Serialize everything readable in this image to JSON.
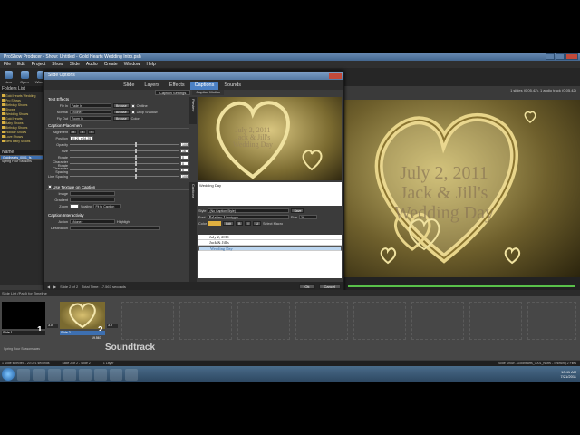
{
  "app": {
    "title": "ProShow Producer - Show: Untitled - Gold Hearts Wedding Intro.psh",
    "menu": [
      "File",
      "Edit",
      "Project",
      "Show",
      "Slide",
      "Audio",
      "Create",
      "Window",
      "Help"
    ],
    "toolbar": [
      "New",
      "Open",
      "Wizard"
    ],
    "info_right": "1 slides (0:05.42), 1 audio track (0:05.42)"
  },
  "left_panel": {
    "folders_title": "Folders List",
    "folders": [
      "Gold Hearts Wedding",
      "Pro Shows",
      "Birthday Shows",
      "Shows",
      "Wedding Shows",
      "Gold Hearts",
      "Baby Shows",
      "Birthday Shows",
      "Holiday Shows",
      "Love Shows",
      "New Baby Shows"
    ],
    "files_title": "Name",
    "files": [
      {
        "name": "Goldhearts_0001_fs",
        "selected": true
      },
      {
        "name": "Spring Four Seasons"
      }
    ]
  },
  "dialog": {
    "title": "Slide Options",
    "tabs": [
      {
        "label": "Slide",
        "active": false
      },
      {
        "label": "Layers",
        "active": false
      },
      {
        "label": "Effects",
        "active": false
      },
      {
        "label": "Captions",
        "active": true
      },
      {
        "label": "Sounds",
        "active": false
      }
    ],
    "subtabs": [
      {
        "label": "Caption Settings",
        "active": true
      },
      {
        "label": "Caption Motion",
        "active": false
      }
    ],
    "text_effects": {
      "title": "Text Effects",
      "fly_in_label": "Fly In",
      "fly_in": "Fade In",
      "normal_label": "Normal",
      "normal": "<None>",
      "fly_out_label": "Fly Out",
      "fly_out": "Zoom In",
      "browse": "Browse",
      "outline_label": "Outline",
      "drop_shadow_label": "Drop Shadow",
      "color_label": "Color"
    },
    "placement": {
      "title": "Caption Placement",
      "alignment_label": "Alignment",
      "position_label": "Position",
      "position": "50.21 x 64.25",
      "opacity_label": "Opacity",
      "opacity": "100",
      "size_label": "Size",
      "size": "16",
      "rotate_label": "Rotate",
      "rotate": "0",
      "char_rotate_label": "Character Rotate",
      "char_rotate": "0",
      "char_spacing_label": "Character Spacing",
      "char_spacing": "0",
      "line_spacing_label": "Line Spacing",
      "line_spacing": "100"
    },
    "texture": {
      "title": "Use Texture on Caption",
      "image_label": "Image",
      "gradient_label": "Gradient",
      "zoom_label": "Zoom",
      "scaling_label": "Scaling",
      "scaling": "Fit to Caption"
    },
    "interactivity": {
      "title": "Caption Interactivity",
      "action_label": "Action",
      "action": "<None>",
      "highlight_label": "Highlight",
      "destination_label": "Destination"
    },
    "caption_text": "Wedding Day",
    "format": {
      "style_label": "Style",
      "style": "(No Caption Style)",
      "save_style": "Save",
      "font_label": "Font",
      "font": "Palatino Linotype",
      "size_label": "Size",
      "size": "36",
      "color_label": "Color",
      "edit_label": "Edit",
      "select_macro": "Select Macro"
    },
    "captions": [
      {
        "text": "July 2, 2011",
        "selected": false
      },
      {
        "text": "Jack & Jill's",
        "selected": false
      },
      {
        "text": "Wedding Day",
        "selected": true
      }
    ],
    "side_labels": {
      "preview": "Preview",
      "captions": "Captions"
    },
    "footer": {
      "slide": "Slide 2 of 2",
      "total": "Total Time: 17.567 seconds",
      "ok": "Ok",
      "cancel": "Cancel"
    }
  },
  "preview": {
    "text": "July 2, 2011\nJack & Jill's\nWedding Day",
    "small_text": "July 2, 2011\nJack & Jill's\nWedding Day"
  },
  "tray": {
    "label": "Slide List (Paid) for Timeline",
    "slides": [
      {
        "name": "Slide 1",
        "num": "1",
        "duration": "3.0",
        "time": "3.0"
      },
      {
        "name": "Slide 2",
        "num": "2",
        "duration": "3.0",
        "time": "19.567"
      }
    ],
    "sound": "Spring Four Seasons.wav",
    "soundtrack": "Soundtrack"
  },
  "status": {
    "left": "1 Slide selected - 20.021 seconds",
    "mid": "Slide 2 of 2 - Slide 2",
    "layer": "1 Layer",
    "right": "Slide Show - Goldhearts_0001_fs.wiv - Showing 2 Files"
  },
  "taskbar": {
    "time": "10:41 AM",
    "date": "7/21/2011"
  }
}
